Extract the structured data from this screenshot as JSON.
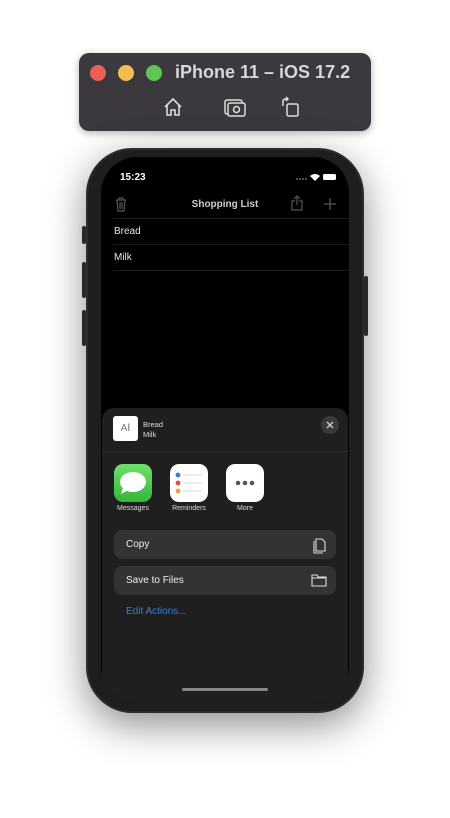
{
  "simulator": {
    "title": "iPhone 11 – iOS 17.2",
    "toolbar": [
      "home-icon",
      "screenshot-icon",
      "rotate-icon"
    ],
    "lights": [
      "#ec5f57",
      "#f4bd4f",
      "#5fc554"
    ]
  },
  "status_bar": {
    "time": "15:23"
  },
  "nav": {
    "title": "Shopping List"
  },
  "list": {
    "items": [
      "Bread",
      "Milk"
    ]
  },
  "share_sheet": {
    "preview": {
      "lines": [
        "Bread",
        "Milk"
      ]
    },
    "apps": [
      {
        "label": "Messages"
      },
      {
        "label": "Reminders"
      },
      {
        "label": "More"
      }
    ],
    "actions": [
      {
        "label": "Copy",
        "icon": "copy-icon"
      },
      {
        "label": "Save to Files",
        "icon": "folder-icon"
      }
    ],
    "edit_actions": "Edit Actions...",
    "accent": "#2f7fe0"
  }
}
